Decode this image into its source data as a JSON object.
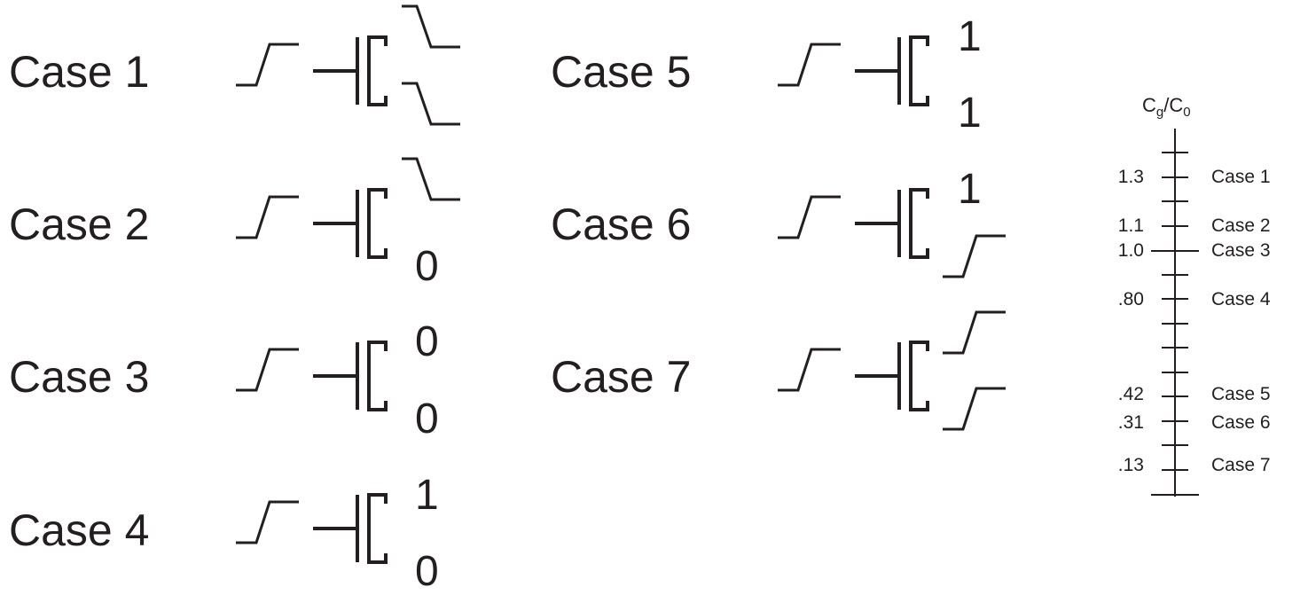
{
  "cases": [
    {
      "label": "Case 1",
      "drain": "",
      "source": ""
    },
    {
      "label": "Case 2",
      "drain": "",
      "source": "0"
    },
    {
      "label": "Case 3",
      "drain": "0",
      "source": "0"
    },
    {
      "label": "Case 4",
      "drain": "1",
      "source": "0"
    },
    {
      "label": "Case 5",
      "drain": "1",
      "source": "1"
    },
    {
      "label": "Case 6",
      "drain": "1",
      "source": ""
    },
    {
      "label": "Case 7",
      "drain": "",
      "source": ""
    }
  ],
  "scale": {
    "title_main": "C",
    "title_sub1": "g",
    "title_slash": "/C",
    "title_sub2": "0",
    "entries": [
      {
        "value": "1.3",
        "case": "Case 1"
      },
      {
        "value": "1.1",
        "case": "Case 2"
      },
      {
        "value": "1.0",
        "case": "Case 3"
      },
      {
        "value": ".80",
        "case": "Case 4"
      },
      {
        "value": ".42",
        "case": "Case 5"
      },
      {
        "value": ".31",
        "case": "Case 6"
      },
      {
        "value": ".13",
        "case": "Case 7"
      }
    ]
  },
  "colors": {
    "ink": "#231f20",
    "background": "#ffffff"
  }
}
